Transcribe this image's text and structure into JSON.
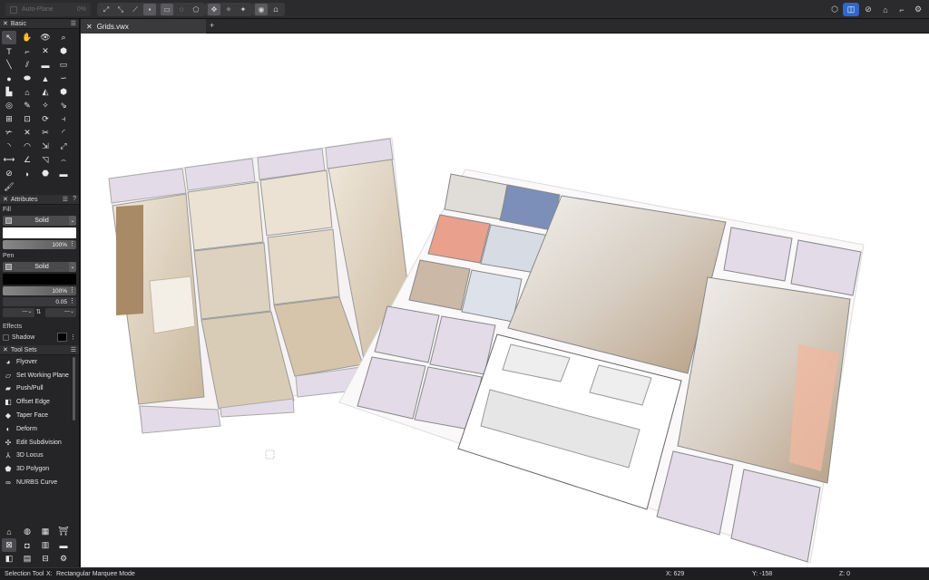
{
  "toolbar": {
    "autoplane_label": "Auto-Plane",
    "autoplane_value": "0%"
  },
  "panels": {
    "basic": "Basic",
    "attributes": "Attributes",
    "fill_label": "Fill",
    "fill_style": "Solid",
    "fill_opacity": "100%",
    "pen_label": "Pen",
    "pen_style": "Solid",
    "pen_opacity": "100%",
    "pen_weight": "0.05",
    "effects_label": "Effects",
    "shadow_label": "Shadow",
    "toolsets": "Tool Sets"
  },
  "tools": [
    {
      "name": "Flyover",
      "icon": "flyover-icon",
      "glyph": "◕"
    },
    {
      "name": "Set Working Plane",
      "icon": "working-plane-icon",
      "glyph": "▱"
    },
    {
      "name": "Push/Pull",
      "icon": "push-pull-icon",
      "glyph": "▰"
    },
    {
      "name": "Offset Edge",
      "icon": "offset-edge-icon",
      "glyph": "◧"
    },
    {
      "name": "Taper Face",
      "icon": "taper-face-icon",
      "glyph": "◆"
    },
    {
      "name": "Deform",
      "icon": "deform-icon",
      "glyph": "◐"
    },
    {
      "name": "Edit Subdivision",
      "icon": "subdivision-icon",
      "glyph": "✣"
    },
    {
      "name": "3D Locus",
      "icon": "locus-icon",
      "glyph": "⅄"
    },
    {
      "name": "3D Polygon",
      "icon": "polygon-3d-icon",
      "glyph": "⬟"
    },
    {
      "name": "NURBS Curve",
      "icon": "nurbs-icon",
      "glyph": "∞"
    }
  ],
  "tab": {
    "title": "Grids.vwx"
  },
  "status": {
    "tool": "Selection Tool",
    "mode_key": "X:",
    "mode": "Rectangular Marquee Mode",
    "x": "X: 629",
    "y": "Y: -158",
    "z": "Z: 0"
  },
  "colors": {
    "accent": "#2d68c9",
    "placeholder": "#e3dbe8",
    "panel_bg": "#252527"
  }
}
